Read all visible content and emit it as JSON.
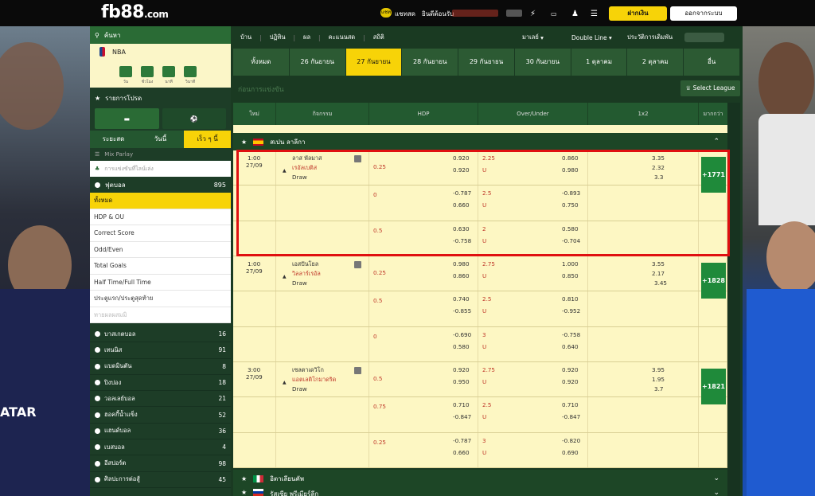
{
  "header": {
    "logo": "fb88",
    "logo_domain": ".com",
    "chat_label": "แชทสด",
    "welcome": "ยินดีต้อนรับ",
    "deposit_button": "ฝากเงิน",
    "logout_button": "ออกจากระบบ",
    "chat_icon_text": "แชท"
  },
  "sidebar": {
    "search_title": "ค้นหา",
    "nba": {
      "label": "NBA",
      "countdown": [
        {
          "v": "",
          "l": "วัน"
        },
        {
          "v": "",
          "l": "ชั่วโมง"
        },
        {
          "v": "",
          "l": "นาที"
        },
        {
          "v": "",
          "l": "วินาที"
        }
      ]
    },
    "favorites_title": "รายการโปรด",
    "mode_tabs": [
      "ระยะสด",
      "วันนี้",
      "เร็ว ๆ นี้"
    ],
    "mix_parlay": "Mix Parlay",
    "search_placeholder": "การแข่งขันที่ไลน์เล่ง",
    "football": {
      "label": "ฟุตบอล",
      "count": "895"
    },
    "bet_types": [
      "ทั้งหมด",
      "HDP & OU",
      "Correct Score",
      "Odd/Even",
      "Total Goals",
      "Half Time/Full Time",
      "ประตูแรก/ประตูสุดท้าย",
      "ทายผลผสมมิ"
    ],
    "sports": [
      {
        "label": "บาสเกตบอล",
        "count": "16"
      },
      {
        "label": "เทนนิส",
        "count": "91"
      },
      {
        "label": "แบดมินตัน",
        "count": "8"
      },
      {
        "label": "ปิงปอง",
        "count": "18"
      },
      {
        "label": "วอลเลย์บอล",
        "count": "21"
      },
      {
        "label": "ฮอคกี้น้ำแข็ง",
        "count": "52"
      },
      {
        "label": "แฮนด์บอล",
        "count": "36"
      },
      {
        "label": "เบสบอล",
        "count": "4"
      },
      {
        "label": "อีสปอร์ต",
        "count": "98"
      },
      {
        "label": "ศิลปะการต่อสู้",
        "count": "45"
      }
    ]
  },
  "nav": {
    "items": [
      "บ้าน",
      "ปฏิทิน",
      "ผล",
      "คะแนนสด",
      "สถิติ"
    ],
    "market": "มาเลย์",
    "line": "Double Line",
    "history": "ประวัติการเดิมพัน"
  },
  "date_tabs": [
    "ทั้งหมด",
    "26 กันยายน",
    "27 กันยายน",
    "28 กันยายน",
    "29 กันยายน",
    "30 กันยายน",
    "1 ตุลาคม",
    "2 ตุลาคม",
    "อื่น"
  ],
  "schedule_label": "ก่อนการแข่งขัน",
  "select_league": "Select League",
  "table_head": [
    "ใหม่",
    "กิจกรรม",
    "HDP",
    "Over/Under",
    "1x2",
    "มากกว่า"
  ],
  "league1": "สเปน ลาลีกา",
  "league2": "อิตาเลียนคัพ",
  "league3": "รัสเซีย พรีเมียร์ลีก",
  "matches": [
    {
      "time": "1:00",
      "date": "27/09",
      "home": "ลาส พัลมาส",
      "away": "เรอัลเบติส",
      "draw": "Draw",
      "more": "+1771",
      "x12": [
        "3.35",
        "2.32",
        "3.3"
      ],
      "lines": [
        {
          "hdp_line": "0.25",
          "hdp_top": "0.920",
          "hdp_bot": "0.920",
          "ou_top_line": "2.25",
          "ou_bot": "U",
          "ou_top": "0.860",
          "ou_bottom": "0.980"
        },
        {
          "hdp_line": "0",
          "hdp_top": "-0.787",
          "hdp_bot": "0.660",
          "ou_top_line": "2.5",
          "ou_bot": "U",
          "ou_top": "-0.893",
          "ou_bottom": "0.750"
        },
        {
          "hdp_line": "0.5",
          "hdp_top": "0.630",
          "hdp_bot": "-0.758",
          "ou_top_line": "2",
          "ou_bot": "U",
          "ou_top": "0.580",
          "ou_bottom": "-0.704"
        }
      ]
    },
    {
      "time": "1:00",
      "date": "27/09",
      "home": "เอสปันโยล",
      "away": "วิลลาร์เรอัล",
      "draw": "Draw",
      "more": "+1828",
      "x12": [
        "3.55",
        "2.17",
        "3.45"
      ],
      "lines": [
        {
          "hdp_line": "0.25",
          "hdp_top": "0.980",
          "hdp_bot": "0.860",
          "ou_top_line": "2.75",
          "ou_bot": "U",
          "ou_top": "1.000",
          "ou_bottom": "0.850"
        },
        {
          "hdp_line": "0.5",
          "hdp_top": "0.740",
          "hdp_bot": "-0.855",
          "ou_top_line": "2.5",
          "ou_bot": "U",
          "ou_top": "0.810",
          "ou_bottom": "-0.952"
        },
        {
          "hdp_line": "0",
          "hdp_top": "-0.690",
          "hdp_bot": "0.580",
          "ou_top_line": "3",
          "ou_bot": "U",
          "ou_top": "-0.758",
          "ou_bottom": "0.640"
        }
      ]
    },
    {
      "time": "3:00",
      "date": "27/09",
      "home": "เซลตาเดวิโก",
      "away": "แอตเลติโกมาดริด",
      "draw": "Draw",
      "more": "+1821",
      "x12": [
        "3.95",
        "1.95",
        "3.7"
      ],
      "lines": [
        {
          "hdp_line": "0.5",
          "hdp_top": "0.920",
          "hdp_bot": "0.950",
          "ou_top_line": "2.75",
          "ou_bot": "U",
          "ou_top": "0.920",
          "ou_bottom": "0.920"
        },
        {
          "hdp_line": "0.75",
          "hdp_top": "0.710",
          "hdp_bot": "-0.847",
          "ou_top_line": "2.5",
          "ou_bot": "U",
          "ou_top": "0.710",
          "ou_bottom": "-0.847"
        },
        {
          "hdp_line": "0.25",
          "hdp_top": "-0.787",
          "hdp_bot": "0.660",
          "ou_top_line": "3",
          "ou_bot": "U",
          "ou_top": "-0.820",
          "ou_bottom": "0.690"
        }
      ]
    }
  ]
}
